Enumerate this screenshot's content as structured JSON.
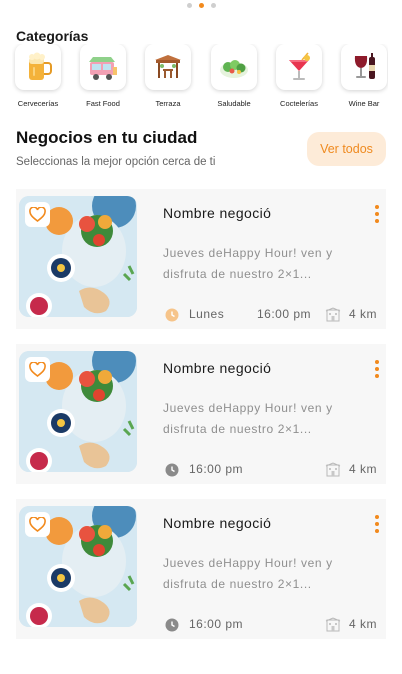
{
  "pager": {
    "pages": 3,
    "active": 2
  },
  "categories": {
    "title": "Categorías",
    "items": [
      {
        "label": "Cervecerías",
        "icon": "beer-icon"
      },
      {
        "label": "Fast Food",
        "icon": "food-truck-icon"
      },
      {
        "label": "Terraza",
        "icon": "terrace-icon"
      },
      {
        "label": "Saludable",
        "icon": "salad-icon"
      },
      {
        "label": "Coctelerías",
        "icon": "cocktail-icon"
      },
      {
        "label": "Wine Bar",
        "icon": "wine-icon"
      }
    ]
  },
  "section": {
    "title": "Negocios en tu ciudad",
    "subtitle": "Seleccionas la mejor opción  cerca de ti",
    "action_label": "Ver todos"
  },
  "businesses": [
    {
      "name": "Nombre negoció",
      "description": "Jueves deHappy Hour! ven y disfruta de nuestro 2×1...",
      "day": "Lunes",
      "time": "16:00 pm",
      "distance": "4 km",
      "clock_color": "#f6c48a"
    },
    {
      "name": "Nombre negoció",
      "description": "Jueves deHappy Hour! ven y disfruta de nuestro 2×1...",
      "day": "",
      "time": "16:00 pm",
      "distance": "4 km",
      "clock_color": "#8a8a8a"
    },
    {
      "name": "Nombre negoció",
      "description": "Jueves deHappy Hour! ven y disfruta de nuestro 2×1...",
      "day": "",
      "time": "16:00 pm",
      "distance": "4 km",
      "clock_color": "#8a8a8a"
    }
  ],
  "colors": {
    "accent": "#f28a1d",
    "accent_soft": "#fdebd8",
    "card_bg": "#f7f7f7"
  }
}
